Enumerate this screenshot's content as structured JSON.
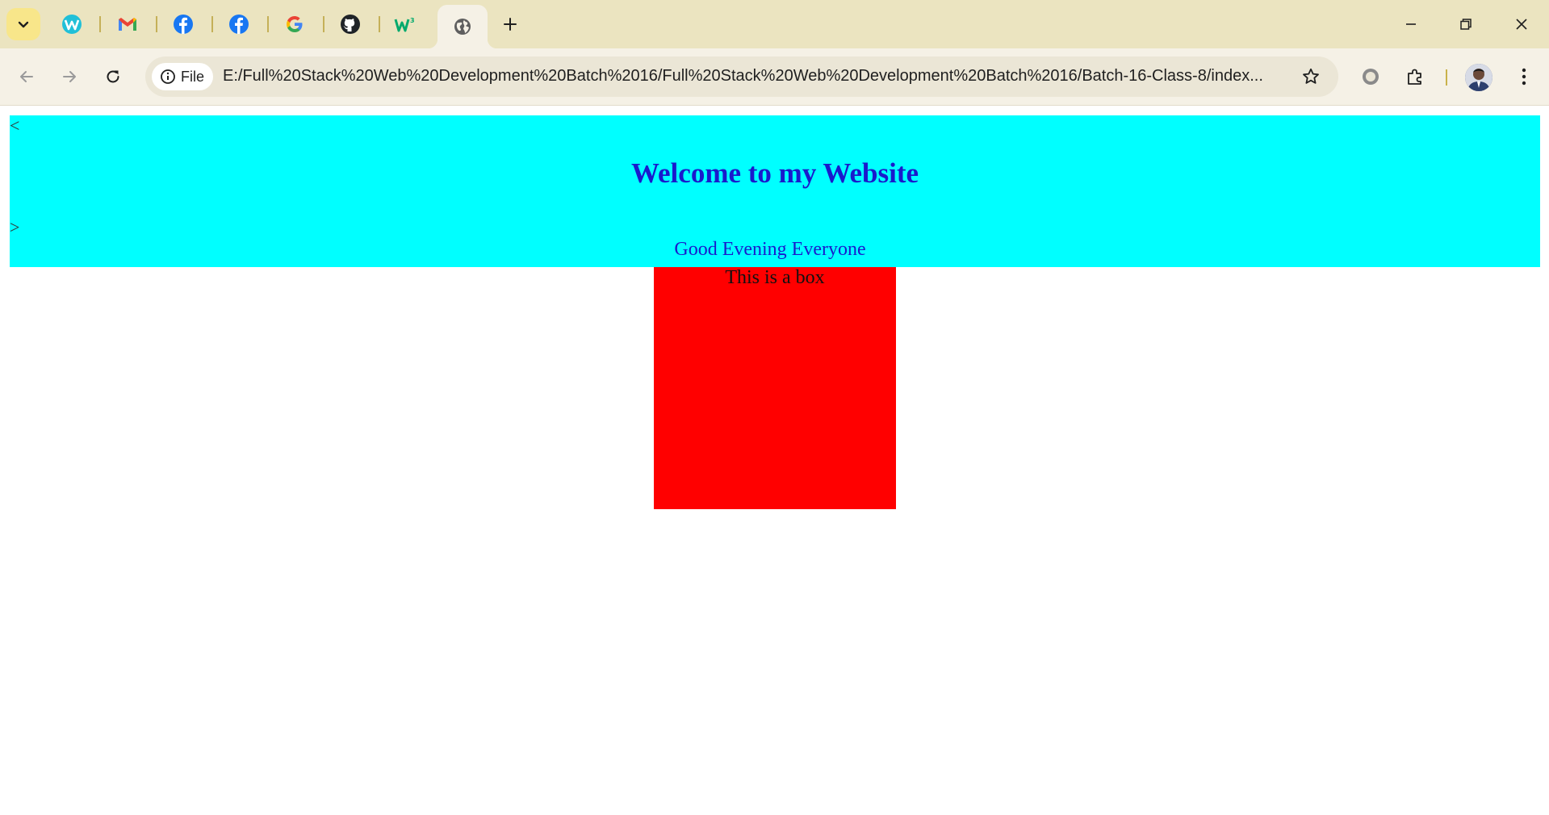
{
  "browser": {
    "tabs": [
      {
        "icon": "wordpress-icon",
        "color": "#21c0d8"
      },
      {
        "icon": "gmail-icon",
        "color": "#ea4335"
      },
      {
        "icon": "facebook-icon",
        "color": "#1877f2"
      },
      {
        "icon": "facebook-icon",
        "color": "#1877f2"
      },
      {
        "icon": "google-icon",
        "color": "#4285f4"
      },
      {
        "icon": "github-icon",
        "color": "#1f2328"
      },
      {
        "icon": "w3schools-icon",
        "color": "#04aa6d"
      },
      {
        "icon": "globe-icon",
        "color": "#5f5f5f",
        "active": true
      }
    ],
    "site_chip_label": "File",
    "url": "E:/Full%20Stack%20Web%20Development%20Batch%2016/Full%20Stack%20Web%20Development%20Batch%2016/Batch-16-Class-8/index..."
  },
  "page": {
    "angle_open": "<",
    "angle_close": ">",
    "heading": "Welcome to my Website",
    "subheading": "Good Evening Everyone",
    "box_text": "This is a box",
    "colors": {
      "hero_background": "#00ffff",
      "heading": "#1a1acc",
      "box_background": "#ff0000"
    }
  }
}
